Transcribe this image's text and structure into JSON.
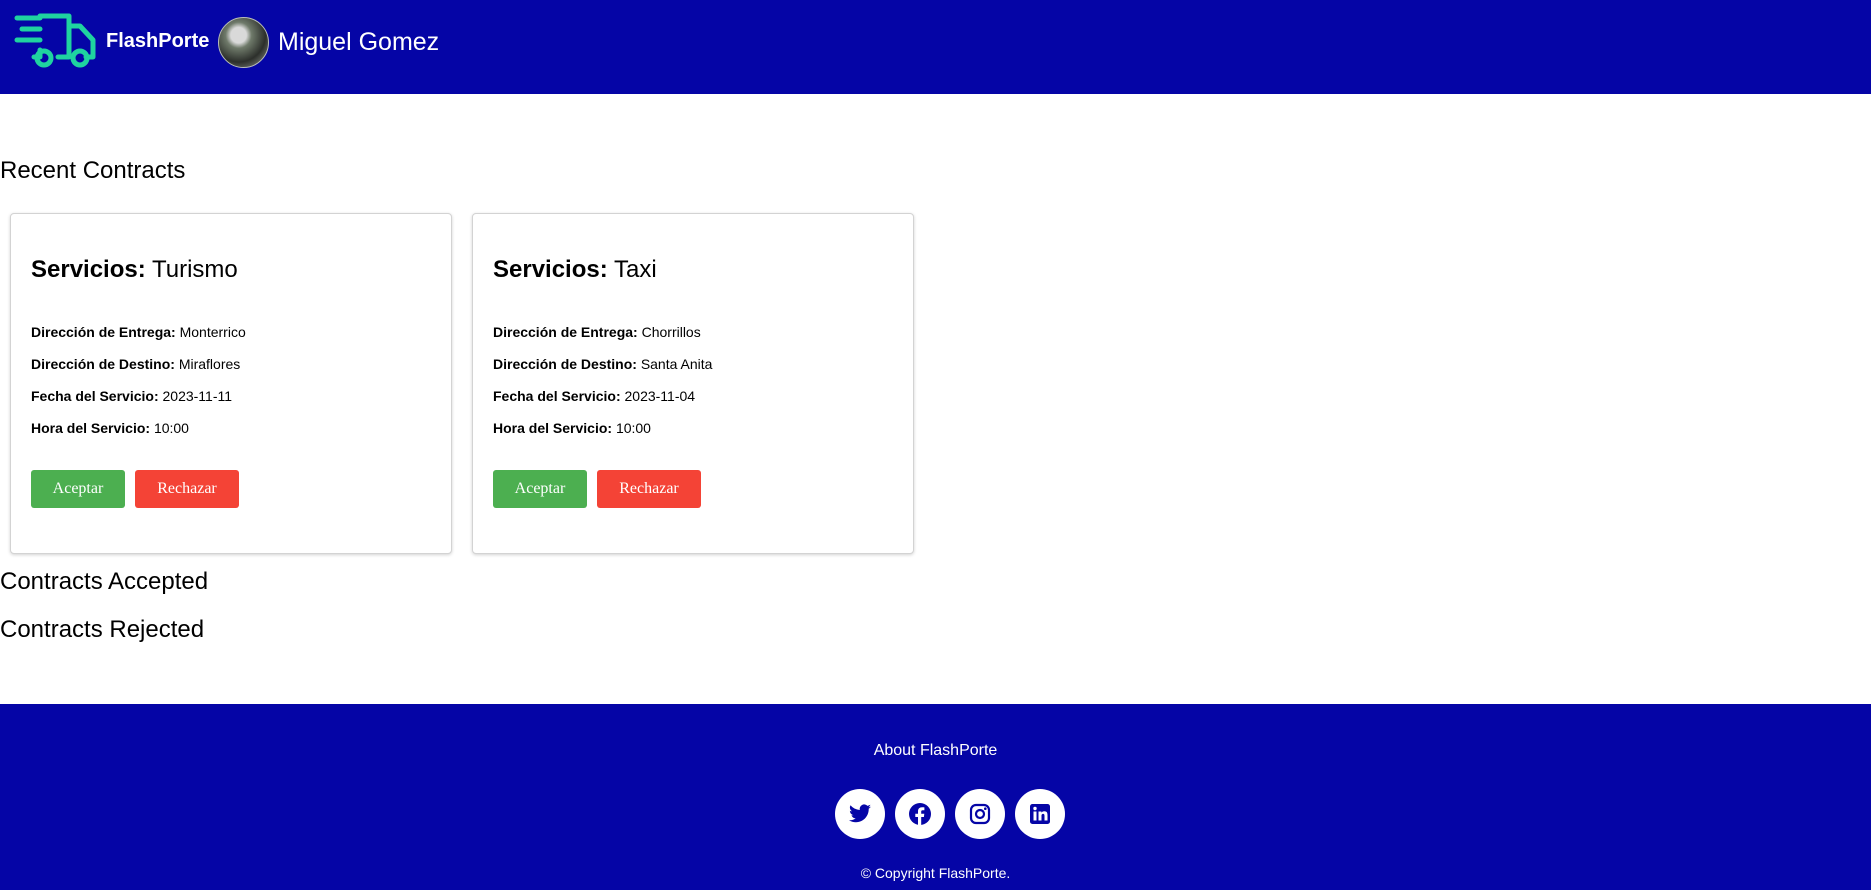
{
  "header": {
    "brand": "FlashPorte",
    "user_name": "Miguel Gomez",
    "logo_icon": "delivery-truck-icon",
    "avatar_icon": "user-avatar"
  },
  "sections": {
    "recent": "Recent Contracts",
    "accepted": "Contracts Accepted",
    "rejected": "Contracts Rejected"
  },
  "labels": {
    "servicios": "Servicios:",
    "entrega": "Dirección de Entrega:",
    "destino": "Dirección de Destino:",
    "fecha": "Fecha del Servicio:",
    "hora": "Hora del Servicio:",
    "accept": "Aceptar",
    "reject": "Rechazar"
  },
  "contracts": [
    {
      "service": "Turismo",
      "entrega": "Monterrico",
      "destino": "Miraflores",
      "fecha": "2023-11-11",
      "hora": "10:00"
    },
    {
      "service": "Taxi",
      "entrega": "Chorrillos",
      "destino": "Santa Anita",
      "fecha": "2023-11-04",
      "hora": "10:00"
    }
  ],
  "footer": {
    "about": "About FlashPorte",
    "copyright": "© Copyright FlashPorte.",
    "socials": [
      "twitter-icon",
      "facebook-icon",
      "instagram-icon",
      "linkedin-icon"
    ]
  },
  "colors": {
    "primary": "#0505a6",
    "brand_logo": "#1fd3a0",
    "accept": "#4caf50",
    "reject": "#f44336"
  }
}
